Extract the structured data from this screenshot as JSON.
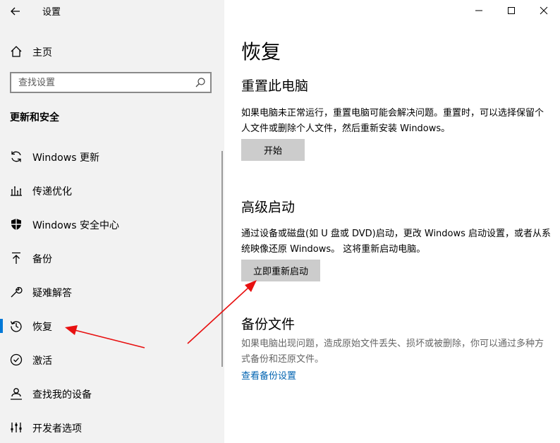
{
  "app": {
    "title": "设置"
  },
  "sidebar": {
    "home_label": "主页",
    "search_placeholder": "查找设置",
    "section_title": "更新和安全",
    "items": [
      {
        "label": "Windows 更新",
        "icon": "sync-icon"
      },
      {
        "label": "传递优化",
        "icon": "delivery-optimization-icon"
      },
      {
        "label": "Windows 安全中心",
        "icon": "shield-icon"
      },
      {
        "label": "备份",
        "icon": "backup-arrow-icon"
      },
      {
        "label": "疑难解答",
        "icon": "wrench-icon"
      },
      {
        "label": "恢复",
        "icon": "history-icon",
        "selected": true
      },
      {
        "label": "激活",
        "icon": "check-circle-icon"
      },
      {
        "label": "查找我的设备",
        "icon": "person-pin-icon"
      },
      {
        "label": "开发者选项",
        "icon": "developer-tools-icon"
      }
    ]
  },
  "main": {
    "page_title": "恢复",
    "reset": {
      "heading": "重置此电脑",
      "description": "如果电脑未正常运行，重置电脑可能会解决问题。重置时，可以选择保留个人文件或删除个人文件，然后重新安装 Windows。",
      "button": "开始"
    },
    "advanced": {
      "heading": "高级启动",
      "description": "通过设备或磁盘(如 U 盘或 DVD)启动，更改 Windows 启动设置，或者从系统映像还原 Windows。 这将重新启动电脑。",
      "button": "立即重新启动"
    },
    "backup": {
      "heading": "备份文件",
      "description": "如果电脑出现问题，造成原始文件丢失、损坏或被删除，你可以通过多种方式备份和还原文件。",
      "link": "查看备份设置"
    }
  },
  "colors": {
    "accent": "#0078d7",
    "link": "#0063b1",
    "sidebar_bg": "#f2f2f2",
    "button_bg": "#cccccc",
    "annotation_arrow": "#e81010"
  }
}
